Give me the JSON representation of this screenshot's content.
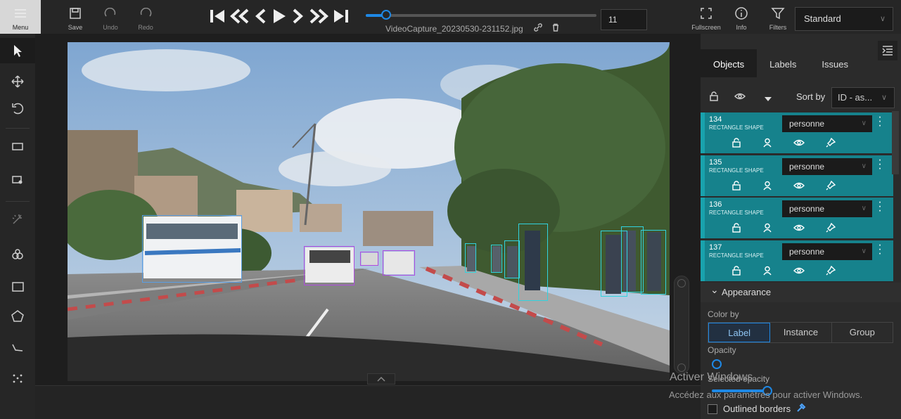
{
  "topbar": {
    "menu_label": "Menu",
    "save_label": "Save",
    "undo_label": "Undo",
    "redo_label": "Redo",
    "filename": "VideoCapture_20230530-231152.jpg",
    "frame_number": "11",
    "fullscreen_label": "Fullscreen",
    "info_label": "Info",
    "filters_label": "Filters",
    "workspace_mode": "Standard",
    "player_progress": 0.06
  },
  "sidebar": {
    "tabs": [
      {
        "label": "Objects"
      },
      {
        "label": "Labels"
      },
      {
        "label": "Issues"
      }
    ],
    "sort_by_label": "Sort by",
    "sort_value": "ID - as...",
    "objects": [
      {
        "id": "134",
        "type": "RECTANGLE SHAPE",
        "label": "personne"
      },
      {
        "id": "135",
        "type": "RECTANGLE SHAPE",
        "label": "personne"
      },
      {
        "id": "136",
        "type": "RECTANGLE SHAPE",
        "label": "personne"
      },
      {
        "id": "137",
        "type": "RECTANGLE SHAPE",
        "label": "personne"
      }
    ],
    "appearance": {
      "title": "Appearance",
      "color_by_label": "Color by",
      "color_by_options": [
        "Label",
        "Instance",
        "Group"
      ],
      "color_by_selected": "Label",
      "opacity_label": "Opacity",
      "selected_opacity_label": "Selected opacity",
      "outlined_borders_label": "Outlined borders"
    }
  },
  "watermark": {
    "line1": "Activer Windows",
    "line2": "Accédez aux paramètres pour activer Windows."
  },
  "colors": {
    "accent": "#1e88e5",
    "object_bg": "#16828c",
    "bbox_person": "#31d3de",
    "bbox_car": "#b04be0",
    "bbox_bus": "#5aa0e6"
  }
}
